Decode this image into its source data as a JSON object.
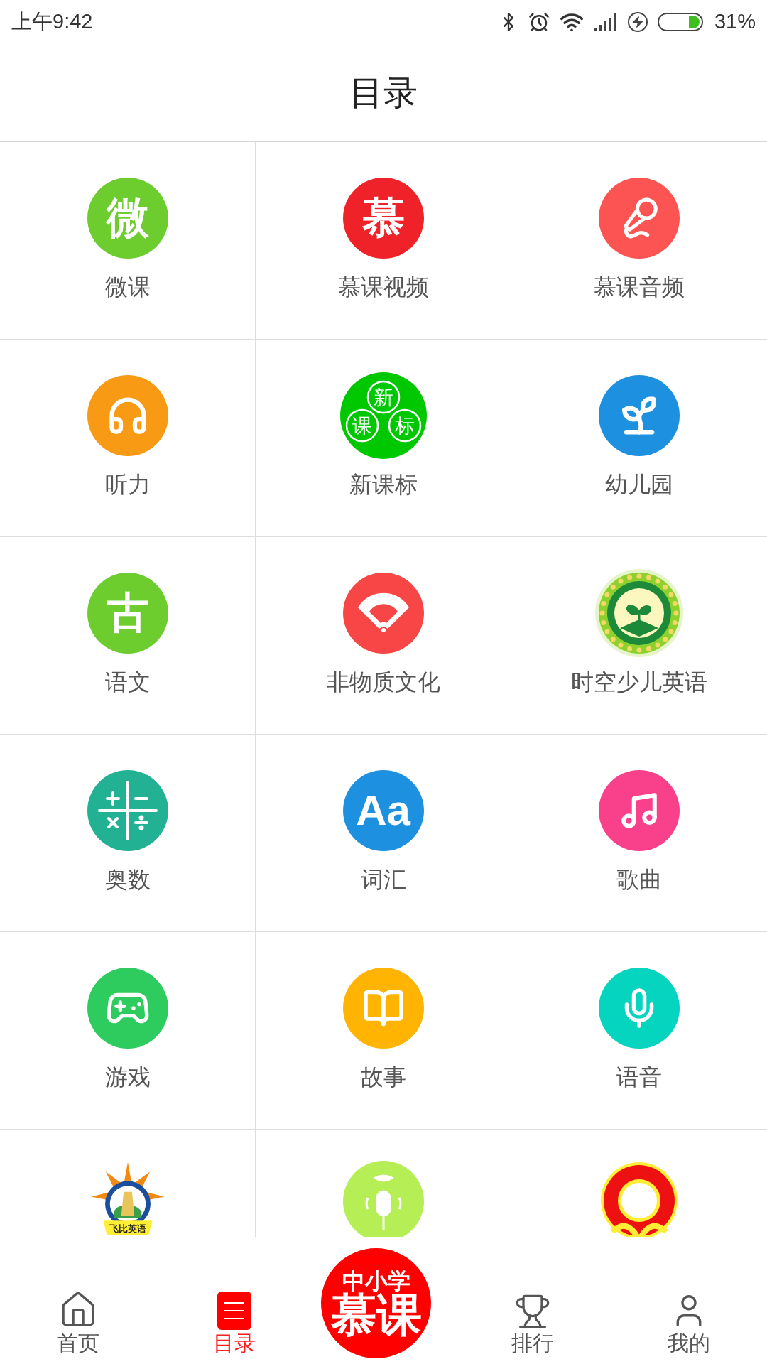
{
  "status_bar": {
    "time": "上午9:42",
    "battery_percent": "31%"
  },
  "header": {
    "title": "目录"
  },
  "grid": {
    "items": [
      {
        "label": "微课",
        "kind": "glyph",
        "glyph": "微",
        "color": "#6dcd2f"
      },
      {
        "label": "慕课视频",
        "kind": "glyph",
        "glyph": "慕",
        "color": "#ee2228"
      },
      {
        "label": "慕课音频",
        "kind": "karaoke",
        "color": "#fc5453"
      },
      {
        "label": "听力",
        "kind": "headphones",
        "color": "#f99a15"
      },
      {
        "label": "新课标",
        "kind": "trio",
        "glyphs": [
          "新",
          "课",
          "标"
        ],
        "color": "#00c800"
      },
      {
        "label": "幼儿园",
        "kind": "sprout",
        "color": "#1e90e0"
      },
      {
        "label": "语文",
        "kind": "glyph",
        "glyph": "古",
        "color": "#6dcd2f"
      },
      {
        "label": "非物质文化",
        "kind": "fan",
        "color": "#f84545"
      },
      {
        "label": "时空少儿英语",
        "kind": "seal"
      },
      {
        "label": "奥数",
        "kind": "math",
        "color": "#23b193"
      },
      {
        "label": "词汇",
        "kind": "glyph",
        "glyph": "Aa",
        "color": "#1e90e0"
      },
      {
        "label": "歌曲",
        "kind": "music",
        "color": "#f9408a"
      },
      {
        "label": "游戏",
        "kind": "gamepad",
        "color": "#2ecc5e"
      },
      {
        "label": "故事",
        "kind": "book",
        "color": "#feb400"
      },
      {
        "label": "语音",
        "kind": "microphone",
        "color": "#05d4bf"
      },
      {
        "kind": "star-badge",
        "banner": "飞比英语"
      },
      {
        "kind": "lips-mic",
        "color": "#b5ee55"
      },
      {
        "kind": "sun-badge"
      }
    ]
  },
  "nav": {
    "items": [
      {
        "label": "首页",
        "kind": "home",
        "selected": false
      },
      {
        "label": "目录",
        "kind": "list",
        "selected": true
      },
      {
        "label": "排行",
        "kind": "trophy",
        "selected": false
      },
      {
        "label": "我的",
        "kind": "user",
        "selected": false
      }
    ],
    "center_button": {
      "line_1": "中小学",
      "line_2": "慕课"
    }
  }
}
